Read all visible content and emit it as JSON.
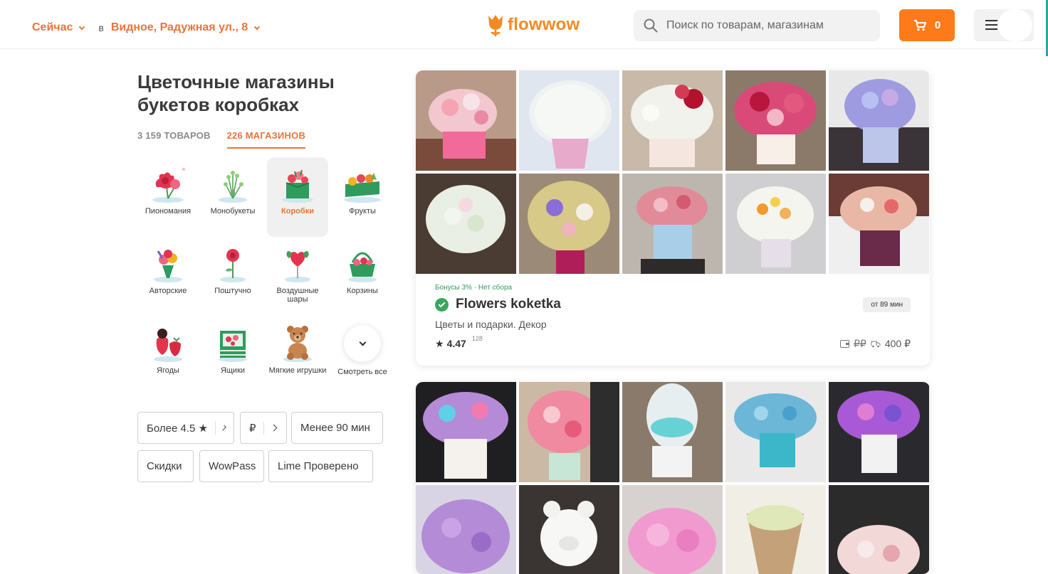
{
  "header": {
    "when": "Сейчас",
    "in_word": "в",
    "address": "Видное, Радужная ул., 8",
    "logo_text": "flowwow",
    "search_placeholder": "Поиск по товарам, магазинам",
    "cart_count": "0",
    "accent_color": "#ff7b1a"
  },
  "page": {
    "title": "Цветочные магазины букетов коробках",
    "tab_products": "3 159 ТОВАРОВ",
    "tab_shops": "226 МАГАЗИНОВ"
  },
  "categories": [
    {
      "label": "Пиономания",
      "icon": "peony-icon"
    },
    {
      "label": "Монобукеты",
      "icon": "monobouquet-icon"
    },
    {
      "label": "Коробки",
      "icon": "flower-box-icon",
      "active": true
    },
    {
      "label": "Фрукты",
      "icon": "fruit-box-icon"
    },
    {
      "label": "Авторские",
      "icon": "author-bouquet-icon"
    },
    {
      "label": "Поштучно",
      "icon": "single-rose-icon"
    },
    {
      "label": "Воздушные шары",
      "icon": "balloon-icon"
    },
    {
      "label": "Корзины",
      "icon": "basket-icon"
    },
    {
      "label": "Ягоды",
      "icon": "berries-icon"
    },
    {
      "label": "Ящики",
      "icon": "crate-icon"
    },
    {
      "label": "Мягкие игрушки",
      "icon": "teddy-bear-icon"
    },
    {
      "label": "Смотреть все",
      "icon": "chevron-down-icon"
    }
  ],
  "filters": {
    "rating": "Более 4.5 ★",
    "price": "₽",
    "time": "Менее 90 мин",
    "discounts": "Скидки",
    "wowpass": "WowPass",
    "lime": "Lime Проверено"
  },
  "shops": [
    {
      "tags": "Бонусы 3% · Нет сбора",
      "name": "Flowers koketka",
      "delivery_time": "от 89 мин",
      "description": "Цветы и подарки. Декор",
      "rating": "4.47",
      "reviews": "128",
      "min_price": "₽₽",
      "delivery_price": "400 ₽"
    }
  ]
}
